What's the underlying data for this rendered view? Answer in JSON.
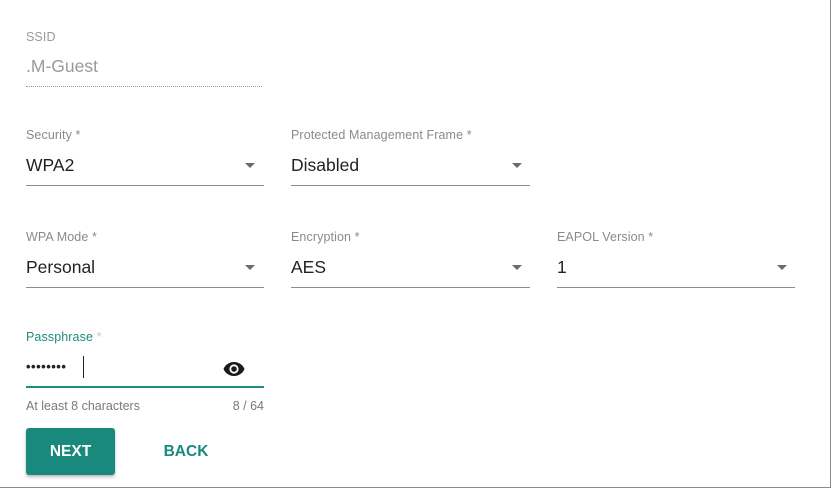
{
  "ssid": {
    "label": "SSID",
    "value": ".M-Guest"
  },
  "security": {
    "label": "Security *",
    "value": "WPA2"
  },
  "pmf": {
    "label": "Protected Management Frame *",
    "value": "Disabled"
  },
  "wpa_mode": {
    "label": "WPA Mode *",
    "value": "Personal"
  },
  "encryption": {
    "label": "Encryption *",
    "value": "AES"
  },
  "eapol": {
    "label": "EAPOL Version *",
    "value": "1"
  },
  "passphrase": {
    "label": "Passphrase",
    "required_mark": "*",
    "masked_value": "••••••••",
    "hint": "At least 8 characters",
    "counter": "8 / 64"
  },
  "buttons": {
    "next": "NEXT",
    "back": "BACK"
  },
  "colors": {
    "accent": "#18897c",
    "label": "#8a8a8a"
  },
  "icons": {
    "dropdown": "triangle-down",
    "visibility": "eye"
  }
}
